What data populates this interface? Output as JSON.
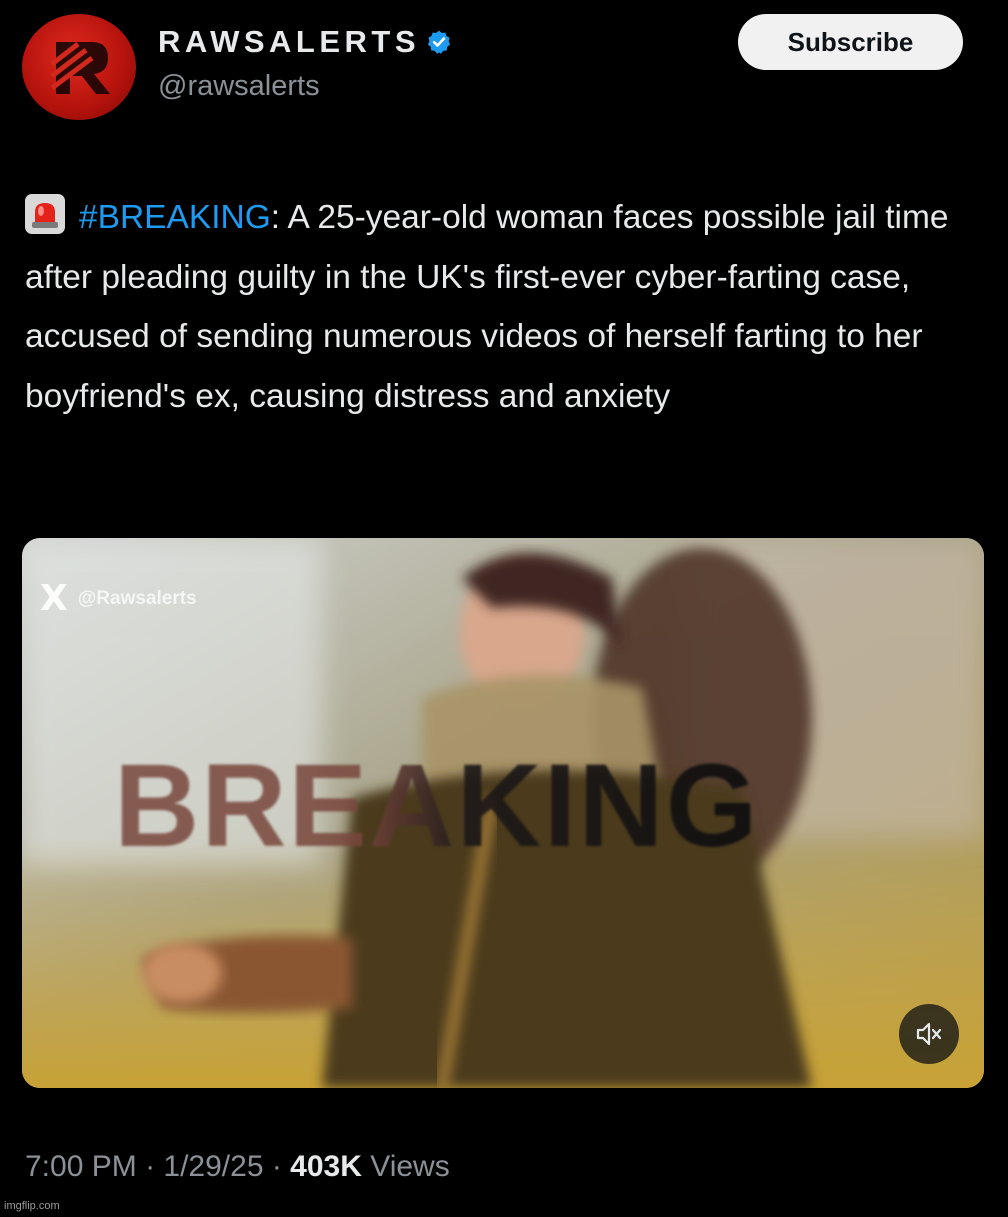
{
  "account": {
    "display_name": "RAWSALERTS",
    "handle": "@rawsalerts",
    "avatar_icon": "rawsalerts-logo-icon",
    "verified_icon": "verified-badge-icon",
    "verified_color": "#1d9bf0"
  },
  "subscribe": {
    "label": "Subscribe"
  },
  "tweet": {
    "emoji_icon": "siren-emoji-icon",
    "hashtag": "#BREAKING",
    "body": ": A 25-year-old woman faces possible jail time after pleading guilty in the UK's first-ever cyber-farting case, accused of sending numerous videos of herself farting to her boyfriend's ex, causing distress and anxiety",
    "hashtag_color": "#1d9bf0"
  },
  "media": {
    "watermark_icon": "x-logo-icon",
    "watermark_logo": "X",
    "watermark_handle": "@Rawsalerts",
    "overlay_text": "BREAKING",
    "mute_icon": "speaker-muted-icon"
  },
  "meta": {
    "time": "7:00 PM",
    "separator": " · ",
    "date": "1/29/25",
    "views_count": "403K",
    "views_label": " Views"
  },
  "site_mark": "imgflip.com"
}
